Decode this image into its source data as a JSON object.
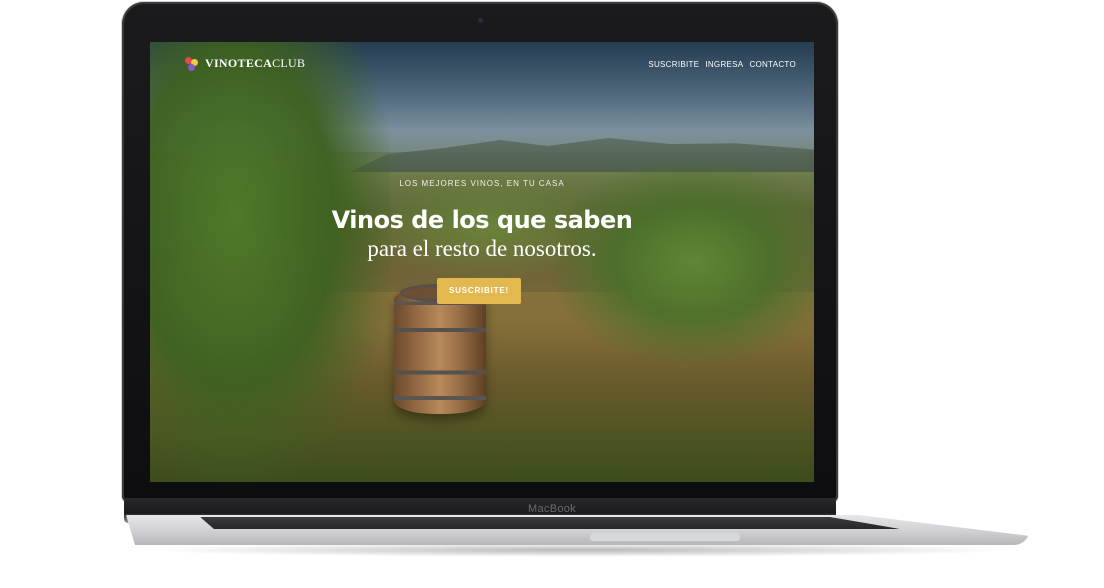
{
  "device": {
    "brand": "MacBook"
  },
  "site": {
    "logo": {
      "name_bold": "VINOTECA",
      "name_light": "CLUB"
    },
    "nav": [
      "SUSCRIBITE",
      "INGRESA",
      "CONTACTO"
    ],
    "hero": {
      "kicker": "LOS MEJORES VINOS, EN TU CASA",
      "headline": "Vinos de los que saben",
      "subheadline": "para el resto de nosotros.",
      "cta_label": "SUSCRIBITE!"
    },
    "colors": {
      "cta": "#e3b94f",
      "logo_dot_red": "#e14b4b",
      "logo_dot_yellow": "#f0c84a",
      "logo_dot_purple": "#8a57c9"
    },
    "background_image": "vineyard with wine barrel"
  }
}
